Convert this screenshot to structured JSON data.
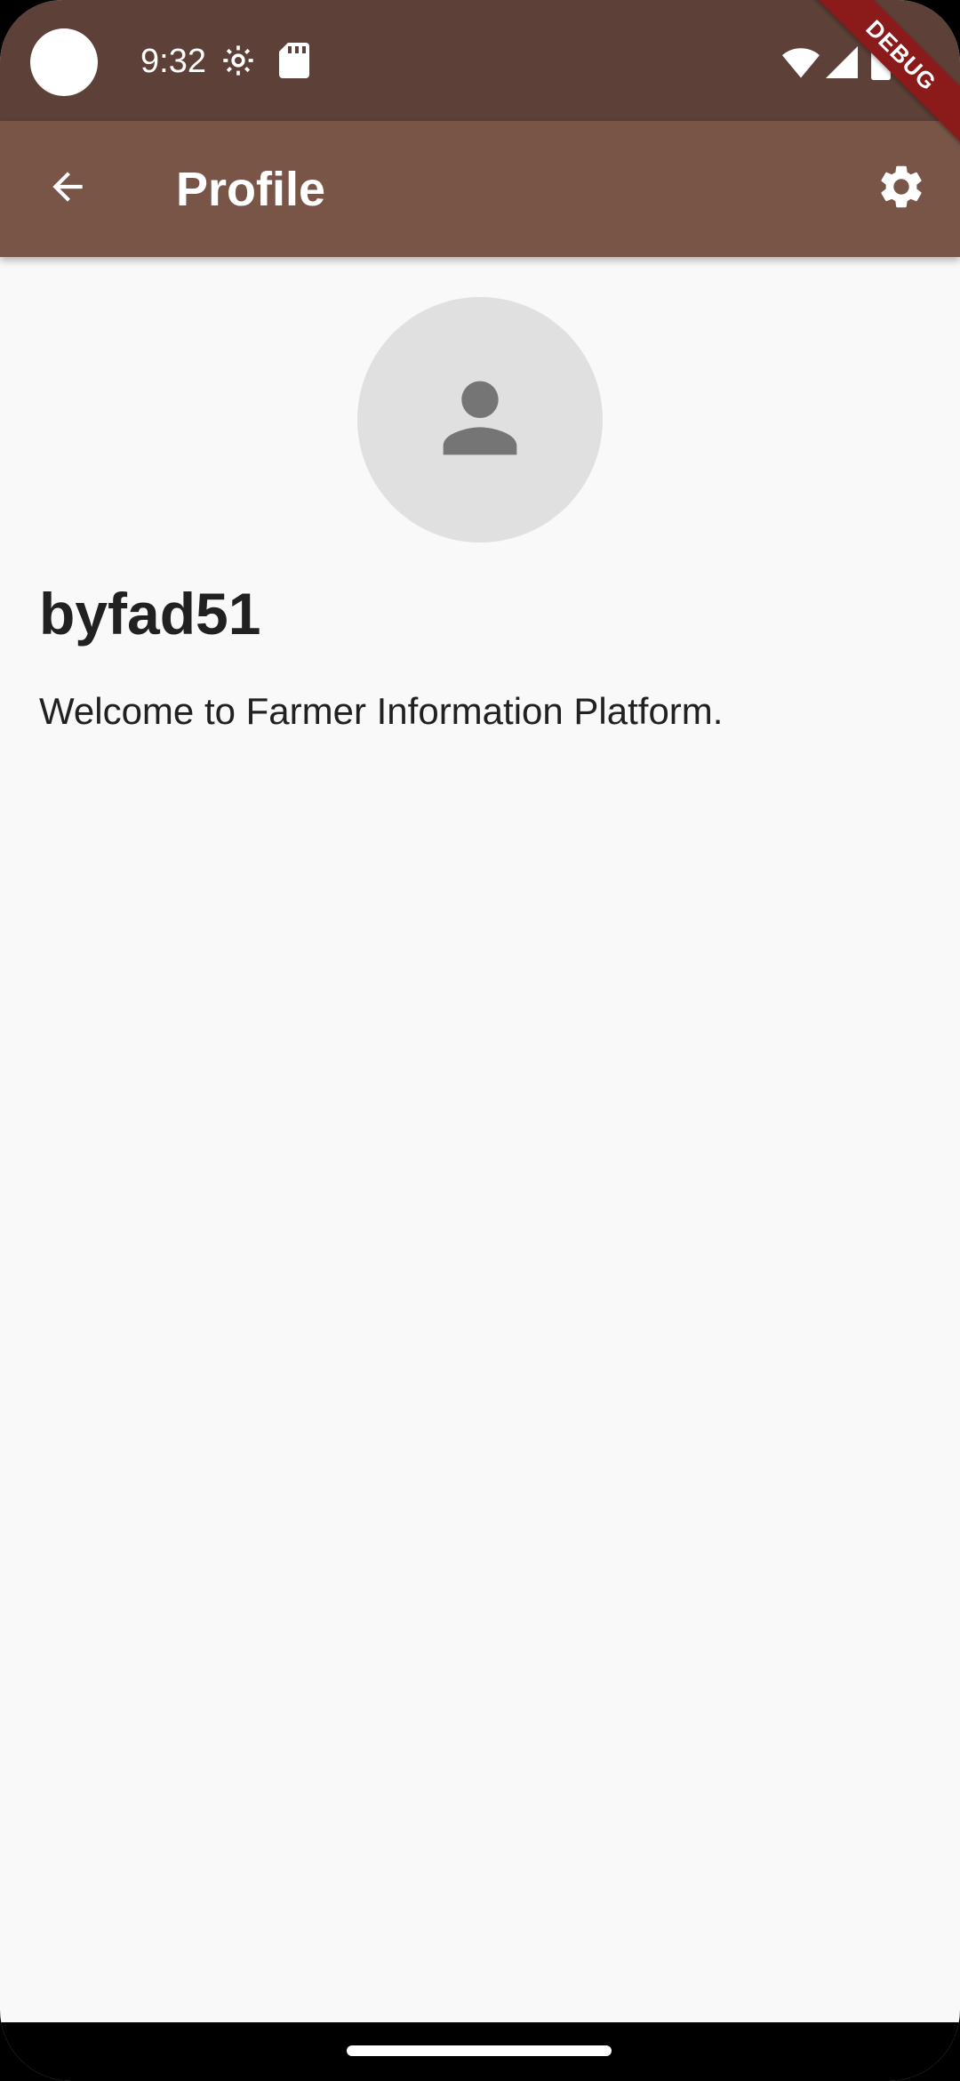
{
  "status_bar": {
    "time": "9:32",
    "icons": [
      "settings-gear-icon",
      "sd-card-icon",
      "wifi-icon",
      "cellular-signal-icon",
      "battery-icon"
    ]
  },
  "debug_banner": {
    "label": "DEBUG"
  },
  "app_bar": {
    "title": "Profile",
    "back_icon": "arrow-back-icon",
    "settings_icon": "settings-icon"
  },
  "profile": {
    "avatar_icon": "person-icon",
    "username": "byfad51",
    "welcome_text": "Welcome to Farmer Information Platform."
  },
  "colors": {
    "status_bar": "#5d4037",
    "app_bar": "#795548",
    "background": "#f9f9f9",
    "avatar_bg": "#e0e0e0",
    "avatar_icon": "#757575",
    "debug_banner": "#8b1a1a"
  }
}
